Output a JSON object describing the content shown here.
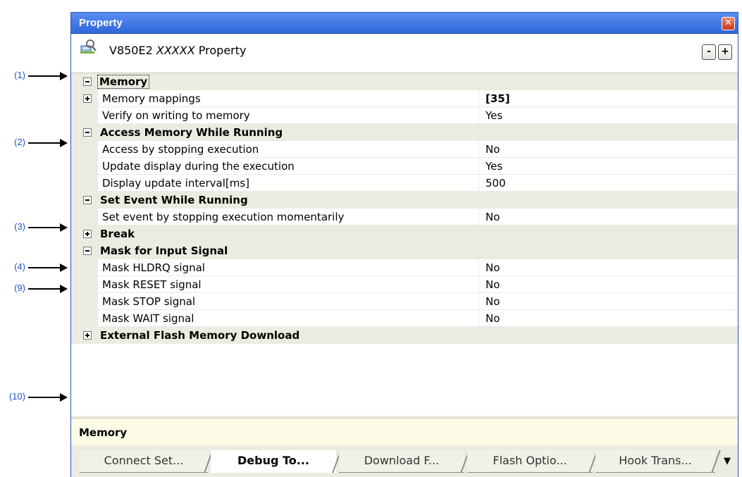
{
  "callouts": [
    "(1)",
    "(2)",
    "(3)",
    "(4)",
    "(9)",
    "(10)"
  ],
  "window": {
    "title": "Property",
    "close_glyph": "✕"
  },
  "header": {
    "title_prefix": "V850E2",
    "title_italic": "XXXXX",
    "title_suffix": "Property",
    "collapse_label": "-",
    "expand_label": "+",
    "icon": "property-panel-icon"
  },
  "grid": {
    "rows": [
      {
        "type": "category",
        "label": "Memory",
        "expanded": true
      },
      {
        "type": "item",
        "name": "Memory mappings",
        "value": "[35]",
        "expandable": true
      },
      {
        "type": "item",
        "name": "Verify on writing to memory",
        "value": "Yes"
      },
      {
        "type": "category",
        "label": "Access Memory While Running",
        "expanded": true
      },
      {
        "type": "item",
        "name": "Access by stopping execution",
        "value": "No"
      },
      {
        "type": "item",
        "name": "Update display during the execution",
        "value": "Yes"
      },
      {
        "type": "item",
        "name": "Display update interval[ms]",
        "value": "500"
      },
      {
        "type": "category",
        "label": "Set Event While Running",
        "expanded": true
      },
      {
        "type": "item",
        "name": "Set event by stopping execution momentarily",
        "value": "No"
      },
      {
        "type": "category",
        "label": "Break",
        "expanded": false
      },
      {
        "type": "category",
        "label": "Mask for Input Signal",
        "expanded": true
      },
      {
        "type": "item",
        "name": "Mask HLDRQ signal",
        "value": "No"
      },
      {
        "type": "item",
        "name": "Mask RESET signal",
        "value": "No"
      },
      {
        "type": "item",
        "name": "Mask STOP signal",
        "value": "No"
      },
      {
        "type": "item",
        "name": "Mask WAIT signal",
        "value": "No"
      },
      {
        "type": "category",
        "label": "External Flash Memory Download",
        "expanded": false
      }
    ]
  },
  "description": {
    "text": "Memory"
  },
  "tabs": [
    {
      "label": "Connect Set...",
      "active": false
    },
    {
      "label": "Debug To...",
      "active": true
    },
    {
      "label": "Download F...",
      "active": false
    },
    {
      "label": "Flash Optio...",
      "active": false
    },
    {
      "label": "Hook Trans...",
      "active": false
    }
  ],
  "tab_overflow": "▼"
}
